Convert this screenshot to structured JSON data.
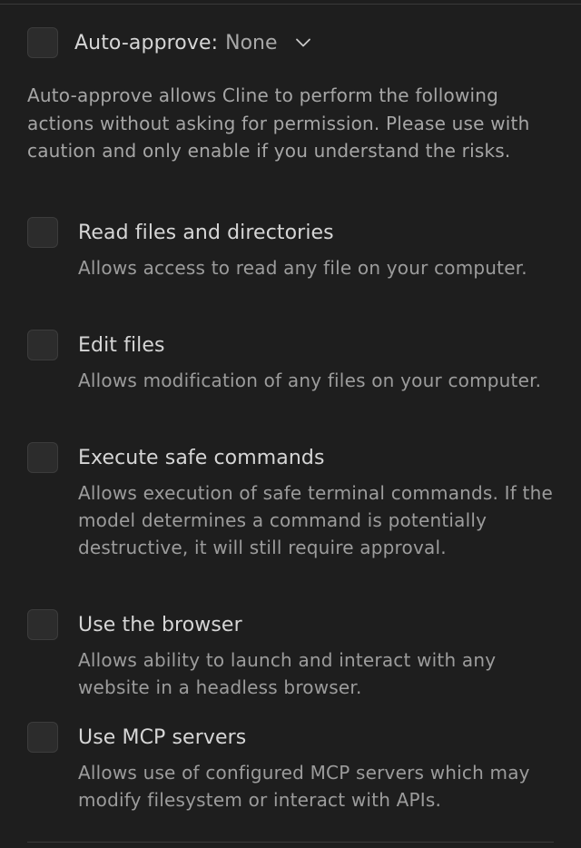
{
  "auto_approve": {
    "label": "Auto-approve:",
    "value": "None",
    "checked": false,
    "description": "Auto-approve allows Cline to perform the following actions without asking for permission. Please use with caution and only enable if you understand the risks."
  },
  "options": [
    {
      "label": "Read files and directories",
      "description": "Allows access to read any file on your computer.",
      "checked": false
    },
    {
      "label": "Edit files",
      "description": "Allows modification of any files on your computer.",
      "checked": false
    },
    {
      "label": "Execute safe commands",
      "description": "Allows execution of safe terminal commands. If the model determines a command is potentially destructive, it will still require approval.",
      "checked": false
    },
    {
      "label": "Use the browser",
      "description": "Allows ability to launch and interact with any website in a headless browser.",
      "checked": false
    },
    {
      "label": "Use MCP servers",
      "description": "Allows use of configured MCP servers which may modify filesystem or interact with APIs.",
      "checked": false
    }
  ],
  "icons": {
    "expand": "chevron-down-icon"
  },
  "colors": {
    "background": "#1e1e1e",
    "checkbox": "#2c2c2c",
    "text_primary": "#d6d6d6",
    "text_secondary": "#9c9c9c"
  }
}
